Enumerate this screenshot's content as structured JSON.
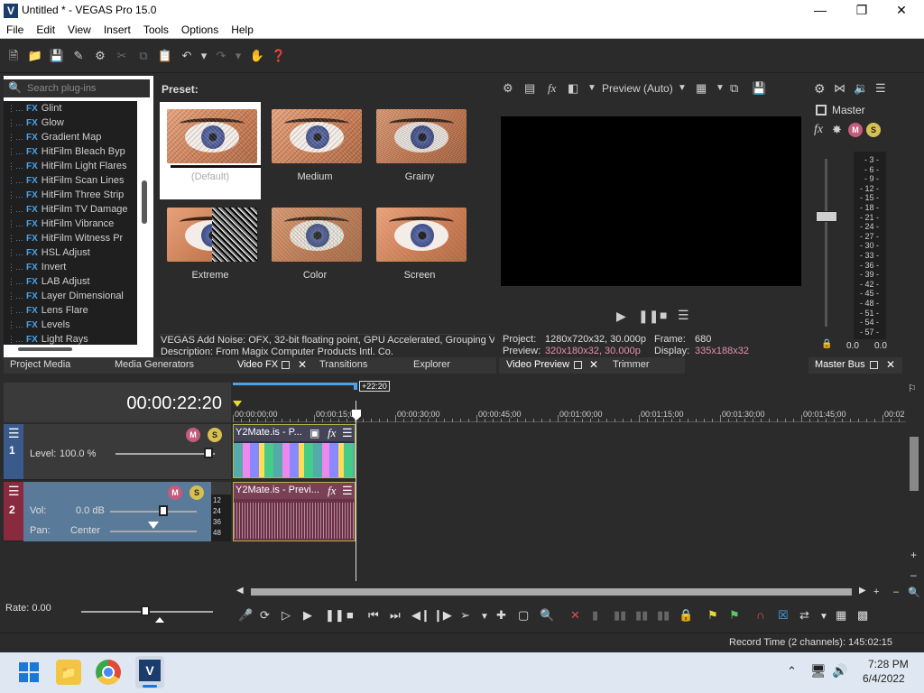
{
  "window": {
    "title": "Untitled * - VEGAS Pro 15.0",
    "app_icon": "V"
  },
  "menu": [
    "File",
    "Edit",
    "View",
    "Insert",
    "Tools",
    "Options",
    "Help"
  ],
  "fx_browser": {
    "search_placeholder": "Search plug-ins",
    "items": [
      "Glint",
      "Glow",
      "Gradient Map",
      "HitFilm Bleach Byp",
      "HitFilm Light Flares",
      "HitFilm Scan Lines",
      "HitFilm Three Strip",
      "HitFilm TV Damage",
      "HitFilm Vibrance",
      "HitFilm Witness Pr",
      "HSL Adjust",
      "Invert",
      "LAB Adjust",
      "Layer Dimensional",
      "Lens Flare",
      "Levels",
      "Light Rays"
    ],
    "fx_badge": "FX"
  },
  "presets": {
    "label": "Preset:",
    "items": [
      {
        "name": "(Default)",
        "style": "default",
        "selected": true
      },
      {
        "name": "Medium",
        "style": "medium"
      },
      {
        "name": "Grainy",
        "style": "grainy"
      },
      {
        "name": "Extreme",
        "style": "extreme"
      },
      {
        "name": "Color",
        "style": "color"
      },
      {
        "name": "Screen",
        "style": "screen"
      }
    ],
    "info_line1": "VEGAS Add Noise: OFX, 32-bit floating point, GPU Accelerated, Grouping VEG",
    "info_line2": "Description: From Magix Computer Products Intl. Co."
  },
  "tabs_left": [
    "Project Media",
    "Media Generators",
    "Video FX",
    "Transitions",
    "Explorer"
  ],
  "preview": {
    "mode": "Preview (Auto)",
    "project_label": "Project:",
    "project_value": "1280x720x32, 30.000p",
    "preview_label": "Preview:",
    "preview_value": "320x180x32, 30.000p",
    "frame_label": "Frame:",
    "frame_value": "680",
    "display_label": "Display:",
    "display_value": "335x188x32",
    "tab_label": "Video Preview",
    "trimmer_label": "Trimmer"
  },
  "master": {
    "label": "Master",
    "tab_label": "Master Bus",
    "scale": [
      "3",
      "6",
      "9",
      "12",
      "15",
      "18",
      "21",
      "24",
      "27",
      "30",
      "33",
      "36",
      "39",
      "42",
      "45",
      "48",
      "51",
      "54",
      "57"
    ],
    "left_value": "0.0",
    "right_value": "0.0"
  },
  "timeline": {
    "timecode": "00:00:22:20",
    "loop_end": "+22:20",
    "ruler": [
      "00:00:00;00",
      "00:00:15;00",
      "00:00:30;00",
      "00:00:45;00",
      "00:01:00;00",
      "00:01:15;00",
      "00:01:30;00",
      "00:01:45;00",
      "00:02"
    ],
    "track1": {
      "number": "1",
      "level_label": "Level:",
      "level_value": "100.0 %",
      "clip": "Y2Mate.is - P..."
    },
    "track2": {
      "number": "2",
      "vol_label": "Vol:",
      "vol_value": "0.0 dB",
      "pan_label": "Pan:",
      "pan_value": "Center",
      "clip": "Y2Mate.is - Previ...",
      "db_ticks": [
        "12",
        "24",
        "36",
        "48"
      ]
    }
  },
  "rate": {
    "label": "Rate: 0.00"
  },
  "status": {
    "record_time": "Record Time (2 channels): 145:02:15"
  },
  "taskbar": {
    "time": "7:28 PM",
    "date": "6/4/2022"
  },
  "colors": {
    "accent": "#4aa3e8",
    "track1": "#3a5a8c",
    "track2": "#8a2a3e",
    "clip_border": "#b5b548"
  }
}
